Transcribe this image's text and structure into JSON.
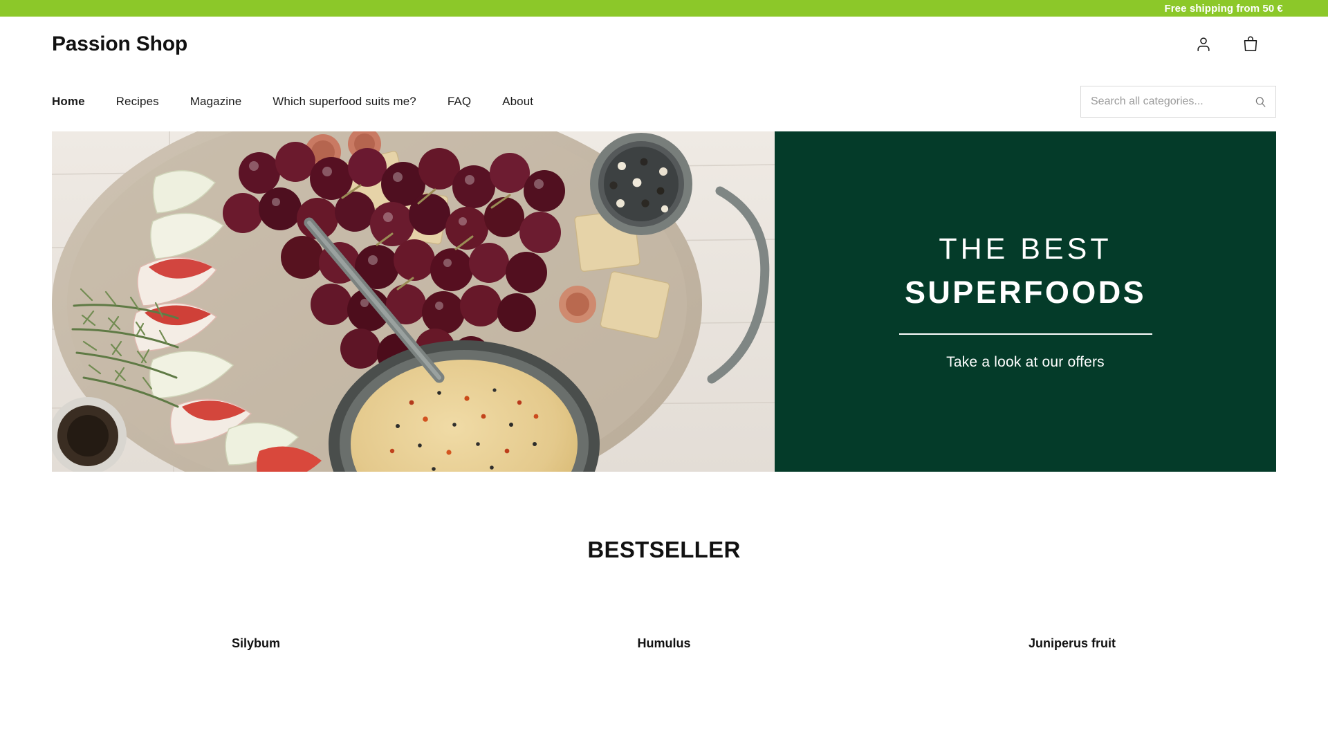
{
  "promo": {
    "text": "Free shipping from 50 €"
  },
  "header": {
    "brand": "Passion Shop",
    "account_icon": "user-icon",
    "cart_icon": "shopping-bag-icon"
  },
  "nav": {
    "items": [
      {
        "label": "Home",
        "active": true
      },
      {
        "label": "Recipes",
        "active": false
      },
      {
        "label": "Magazine",
        "active": false
      },
      {
        "label": "Which superfood suits me?",
        "active": false
      },
      {
        "label": "FAQ",
        "active": false
      },
      {
        "label": "About",
        "active": false
      }
    ]
  },
  "search": {
    "placeholder": "Search all categories...",
    "value": "",
    "icon": "search-icon"
  },
  "hero": {
    "image_alt": "charcuterie board with grapes, apple slices, rosemary and cheese dip",
    "title_light": "THE BEST",
    "title_bold": "SUPERFOODS",
    "subtitle": "Take a look at our offers",
    "panel_color": "#043b29"
  },
  "bestseller": {
    "heading": "BESTSELLER",
    "products": [
      {
        "name": "Silybum"
      },
      {
        "name": "Humulus"
      },
      {
        "name": "Juniperus fruit"
      }
    ]
  },
  "colors": {
    "promo_green": "#8cc829",
    "hero_green": "#043b29",
    "text_dark": "#111111"
  }
}
